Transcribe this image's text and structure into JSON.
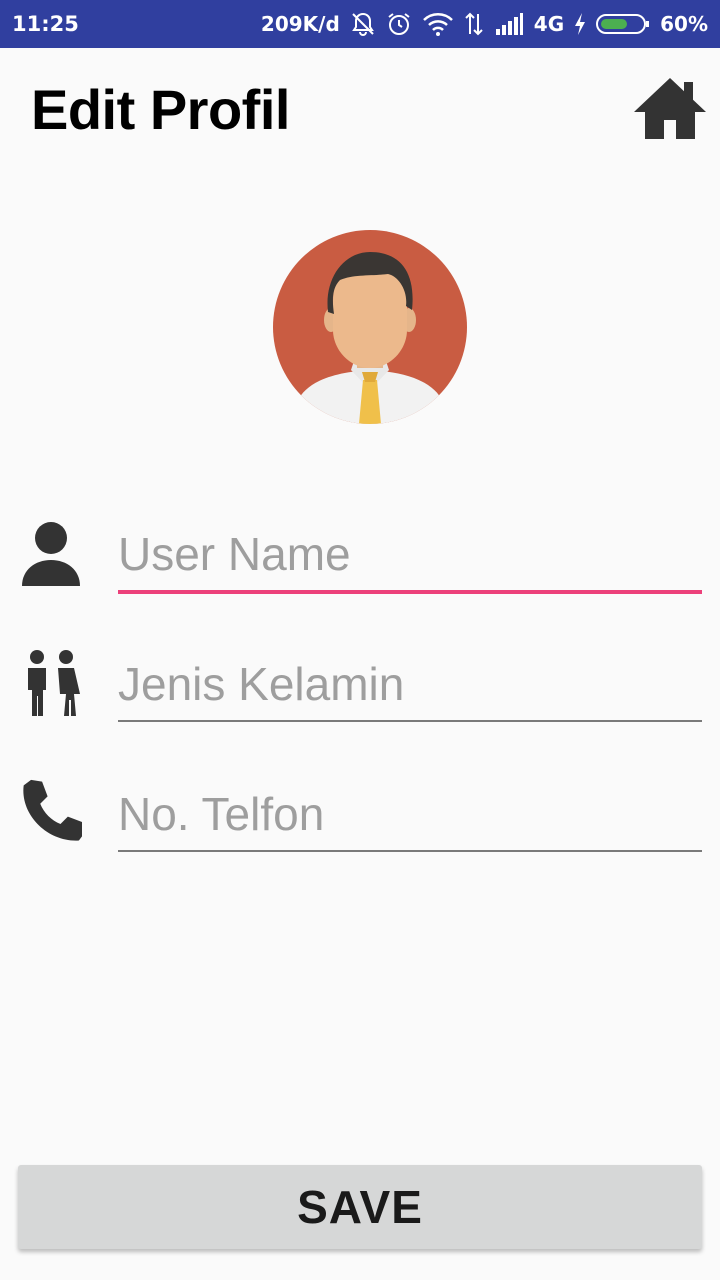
{
  "status_bar": {
    "time": "11:25",
    "net_speed": "209K/d",
    "network_type": "4G",
    "battery": "60%",
    "icons": [
      "mute-icon",
      "alarm-icon",
      "wifi-icon",
      "data-arrows-icon",
      "signal-icon",
      "charging-icon",
      "battery-icon"
    ],
    "color": "#303f9f"
  },
  "header": {
    "title": "Edit Profil",
    "home_icon": "home-icon"
  },
  "avatar": {
    "icon": "user-avatar-icon",
    "background_color": "#c95c42"
  },
  "form": {
    "username": {
      "placeholder": "User Name",
      "value": "",
      "icon": "person-icon",
      "focused": true
    },
    "gender": {
      "placeholder": "Jenis Kelamin",
      "value": "",
      "icon": "gender-icon"
    },
    "phone": {
      "placeholder": "No. Telfon",
      "value": "",
      "icon": "phone-icon"
    },
    "accent_color": "#ec407a"
  },
  "save_button": {
    "label": "SAVE"
  }
}
